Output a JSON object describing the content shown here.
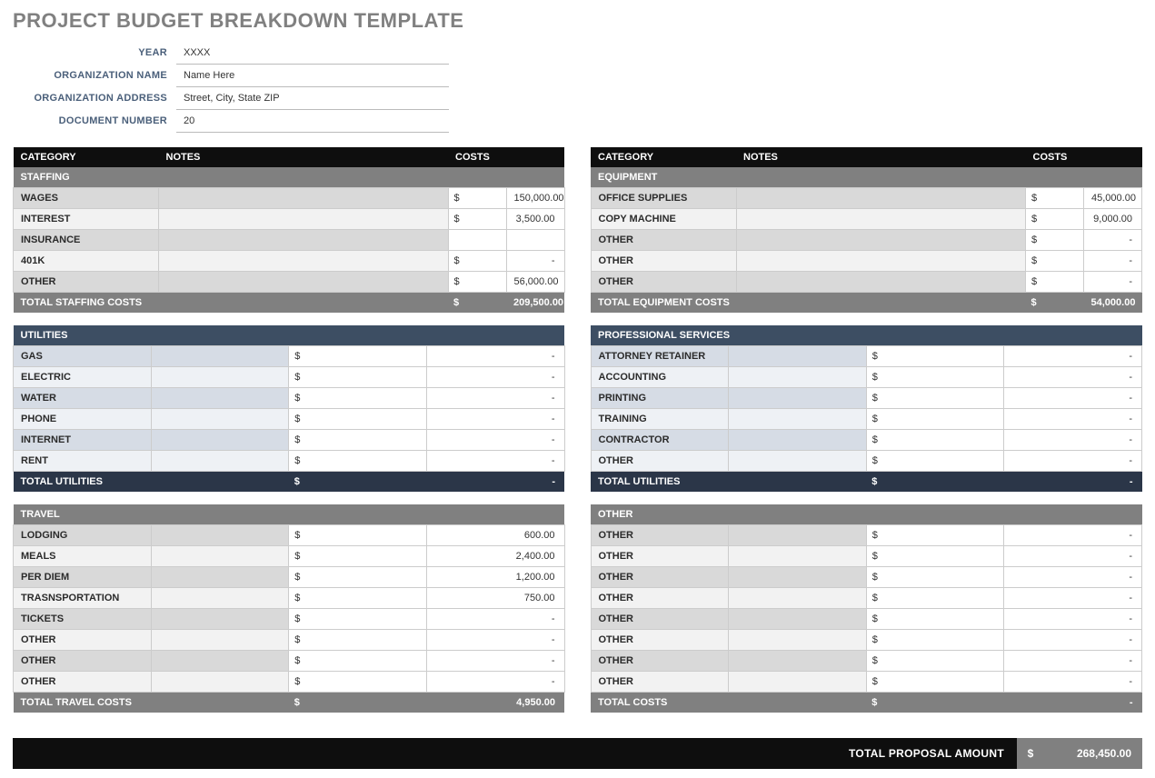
{
  "title": "PROJECT BUDGET BREAKDOWN TEMPLATE",
  "meta": {
    "year_label": "YEAR",
    "year_value": "XXXX",
    "org_name_label": "ORGANIZATION NAME",
    "org_name_value": "Name Here",
    "org_addr_label": "ORGANIZATION ADDRESS",
    "org_addr_value": "Street, City, State ZIP",
    "doc_num_label": "DOCUMENT NUMBER",
    "doc_num_value": "20"
  },
  "headers": {
    "category": "CATEGORY",
    "notes": "NOTES",
    "costs": "COSTS"
  },
  "currency": "$",
  "left": {
    "staffing": {
      "title": "STAFFING",
      "rows": [
        {
          "name": "WAGES",
          "notes": "",
          "amount": "150,000.00"
        },
        {
          "name": "INTEREST",
          "notes": "",
          "amount": "3,500.00"
        },
        {
          "name": "INSURANCE",
          "notes": "",
          "amount": ""
        },
        {
          "name": "401K",
          "notes": "",
          "amount": "-"
        },
        {
          "name": "OTHER",
          "notes": "",
          "amount": "56,000.00"
        }
      ],
      "total_label": "TOTAL STAFFING COSTS",
      "total": "209,500.00"
    },
    "utilities": {
      "title": "UTILITIES",
      "rows": [
        {
          "name": "GAS",
          "notes": "",
          "amount": "-"
        },
        {
          "name": "ELECTRIC",
          "notes": "",
          "amount": "-"
        },
        {
          "name": "WATER",
          "notes": "",
          "amount": "-"
        },
        {
          "name": "PHONE",
          "notes": "",
          "amount": "-"
        },
        {
          "name": "INTERNET",
          "notes": "",
          "amount": "-"
        },
        {
          "name": "RENT",
          "notes": "",
          "amount": "-"
        }
      ],
      "total_label": "TOTAL UTILITIES",
      "total": "-"
    },
    "travel": {
      "title": "TRAVEL",
      "rows": [
        {
          "name": "LODGING",
          "notes": "",
          "amount": "600.00"
        },
        {
          "name": "MEALS",
          "notes": "",
          "amount": "2,400.00"
        },
        {
          "name": "PER DIEM",
          "notes": "",
          "amount": "1,200.00"
        },
        {
          "name": "TRASNSPORTATION",
          "notes": "",
          "amount": "750.00"
        },
        {
          "name": "TICKETS",
          "notes": "",
          "amount": "-"
        },
        {
          "name": "OTHER",
          "notes": "",
          "amount": "-"
        },
        {
          "name": "OTHER",
          "notes": "",
          "amount": "-"
        },
        {
          "name": "OTHER",
          "notes": "",
          "amount": "-"
        }
      ],
      "total_label": "TOTAL TRAVEL COSTS",
      "total": "4,950.00"
    }
  },
  "right": {
    "equipment": {
      "title": "EQUIPMENT",
      "rows": [
        {
          "name": "OFFICE SUPPLIES",
          "notes": "",
          "amount": "45,000.00"
        },
        {
          "name": "COPY MACHINE",
          "notes": "",
          "amount": "9,000.00"
        },
        {
          "name": "OTHER",
          "notes": "",
          "amount": "-"
        },
        {
          "name": "OTHER",
          "notes": "",
          "amount": "-"
        },
        {
          "name": "OTHER",
          "notes": "",
          "amount": "-"
        }
      ],
      "total_label": "TOTAL EQUIPMENT COSTS",
      "total": "54,000.00"
    },
    "services": {
      "title": "PROFESSIONAL SERVICES",
      "rows": [
        {
          "name": "ATTORNEY RETAINER",
          "notes": "",
          "amount": "-"
        },
        {
          "name": "ACCOUNTING",
          "notes": "",
          "amount": "-"
        },
        {
          "name": "PRINTING",
          "notes": "",
          "amount": "-"
        },
        {
          "name": "TRAINING",
          "notes": "",
          "amount": "-"
        },
        {
          "name": "CONTRACTOR",
          "notes": "",
          "amount": "-"
        },
        {
          "name": "OTHER",
          "notes": "",
          "amount": "-"
        }
      ],
      "total_label": "TOTAL UTILITIES",
      "total": "-"
    },
    "other": {
      "title": "OTHER",
      "rows": [
        {
          "name": "OTHER",
          "notes": "",
          "amount": "-"
        },
        {
          "name": "OTHER",
          "notes": "",
          "amount": "-"
        },
        {
          "name": "OTHER",
          "notes": "",
          "amount": "-"
        },
        {
          "name": "OTHER",
          "notes": "",
          "amount": "-"
        },
        {
          "name": "OTHER",
          "notes": "",
          "amount": "-"
        },
        {
          "name": "OTHER",
          "notes": "",
          "amount": "-"
        },
        {
          "name": "OTHER",
          "notes": "",
          "amount": "-"
        },
        {
          "name": "OTHER",
          "notes": "",
          "amount": "-"
        }
      ],
      "total_label": "TOTAL COSTS",
      "total": "-"
    }
  },
  "grand": {
    "label": "TOTAL PROPOSAL AMOUNT",
    "total": "268,450.00"
  }
}
